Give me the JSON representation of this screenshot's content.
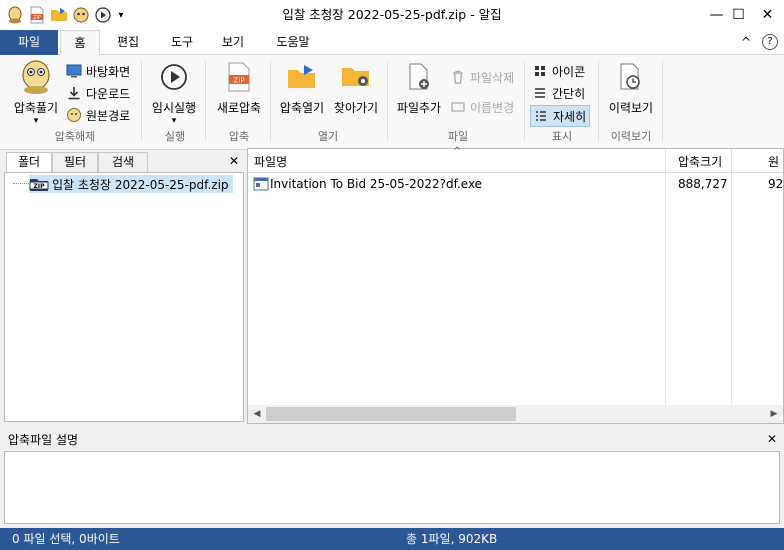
{
  "window": {
    "title": "입찰 초청장 2022-05-25-pdf.zip - 알집",
    "minimize": "—",
    "maximize": "☐",
    "close": "✕"
  },
  "qat": {
    "dropdown": "▾"
  },
  "tabs": [
    {
      "label": "파일"
    },
    {
      "label": "홈"
    },
    {
      "label": "편집"
    },
    {
      "label": "도구"
    },
    {
      "label": "보기"
    },
    {
      "label": "도움말"
    }
  ],
  "ribbon_right": {
    "collapse": "^",
    "help": "?"
  },
  "ribbon": {
    "extract": {
      "label": "압축풀기",
      "arrow": "▾",
      "desktop": "바탕화면",
      "download": "다운로드",
      "original": "원본경로",
      "group": "압축해제"
    },
    "run": {
      "label": "임시실행",
      "arrow": "▾",
      "group": "실행"
    },
    "compress": {
      "label": "새로압축",
      "group": "압축"
    },
    "open": {
      "open_label": "압축열기",
      "find_label": "찾아가기",
      "group": "열기"
    },
    "file": {
      "add_label": "파일추가",
      "delete_label": "파일삭제",
      "rename_label": "이름변경",
      "group": "파일"
    },
    "view": {
      "icon_label": "아이콘",
      "simple_label": "간단히",
      "detail_label": "자세히",
      "group": "표시"
    },
    "history": {
      "label": "이력보기",
      "group": "이력보기"
    }
  },
  "left_panel": {
    "tabs": [
      "폴더",
      "필터",
      "검색"
    ],
    "close": "✕",
    "tree_item": "입찰 초청장 2022-05-25-pdf.zip"
  },
  "file_list": {
    "sort_indicator": "^",
    "columns": [
      "파일명",
      "압축크기",
      "원"
    ],
    "rows": [
      {
        "name": "Invitation To Bid 25-05-2022?df.exe",
        "compressed": "888,727",
        "original": "92"
      }
    ]
  },
  "scroll": {
    "left": "◀",
    "right": "▶"
  },
  "description": {
    "title": "압축파일 설명",
    "close": "✕"
  },
  "status": {
    "left": "0 파일 선택,  0바이트",
    "center": "총 1파일,  902KB"
  }
}
